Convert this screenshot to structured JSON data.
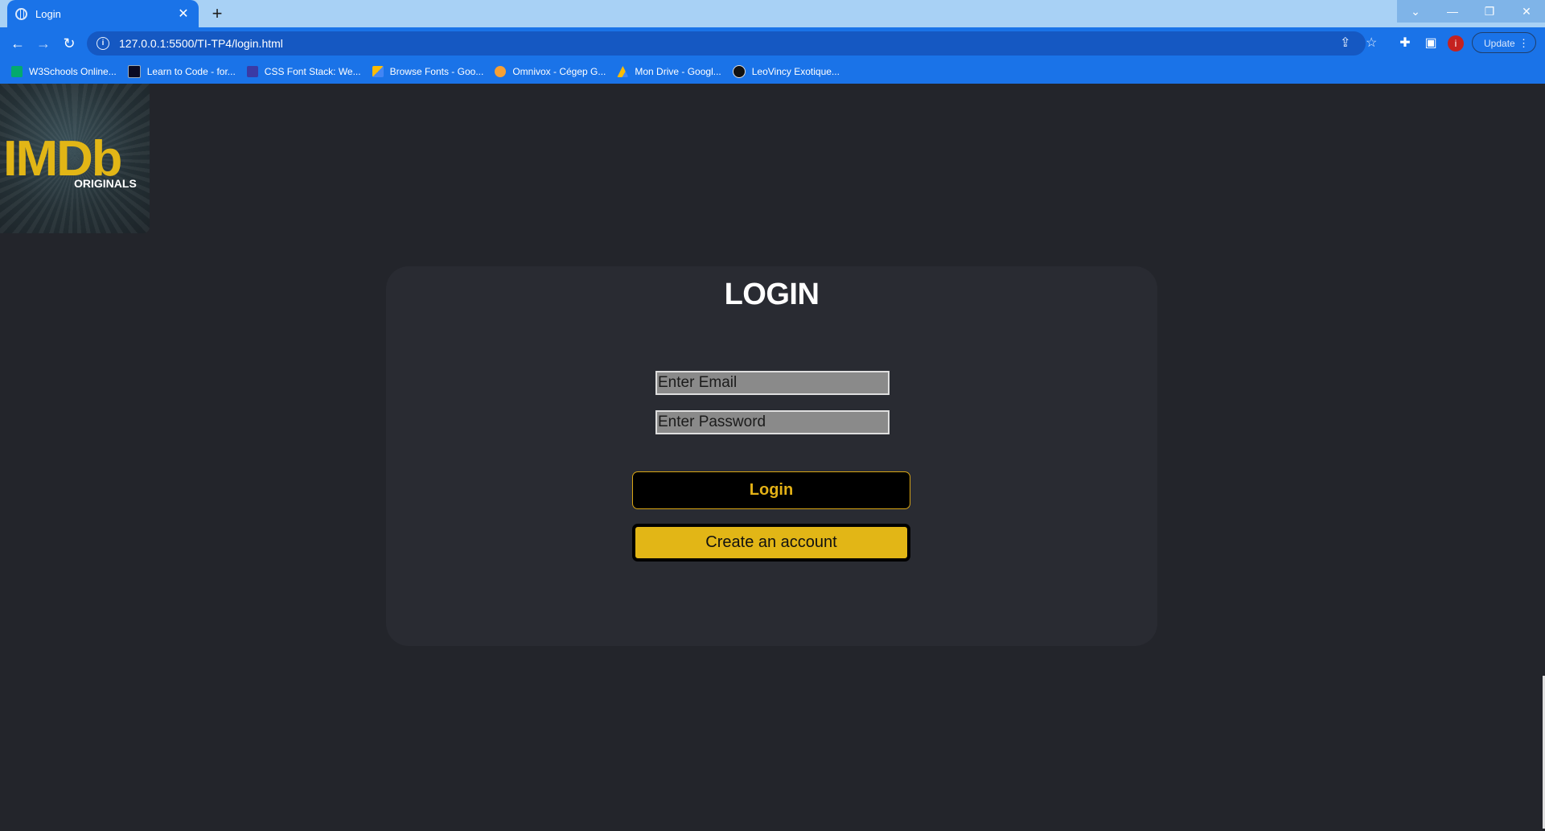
{
  "browser": {
    "tab_title": "Login",
    "tab_close": "✕",
    "new_tab": "+",
    "url": "127.0.0.1:5500/TI-TP4/login.html",
    "update_label": "Update",
    "avatar_letter": "i",
    "window_controls": [
      "⌄",
      "—",
      "❐",
      "✕"
    ],
    "bookmarks": [
      {
        "label": "W3Schools Online...",
        "color": "#04aa6d"
      },
      {
        "label": "Learn to Code - for...",
        "color": "#0a0a23"
      },
      {
        "label": "CSS Font Stack: We...",
        "color": "#3a3aa5"
      },
      {
        "label": "Browse Fonts - Goo...",
        "color": "#fbbc04"
      },
      {
        "label": "Omnivox - Cégep G...",
        "color": "#f7a034"
      },
      {
        "label": "Mon Drive - Googl...",
        "color": "#34a853"
      },
      {
        "label": "LeoVincy Exotique...",
        "color": "#111111"
      }
    ]
  },
  "logo": {
    "brand": "IMDb",
    "sub": "ORIGINALS"
  },
  "login": {
    "heading": "LOGIN",
    "email_placeholder": "Enter Email",
    "password_placeholder": "Enter Password",
    "login_button": "Login",
    "create_button": "Create an account"
  },
  "colors": {
    "page_bg": "#23252b",
    "card_bg": "#292b32",
    "accent": "#e2b616",
    "chrome_blue": "#1a73e8"
  }
}
